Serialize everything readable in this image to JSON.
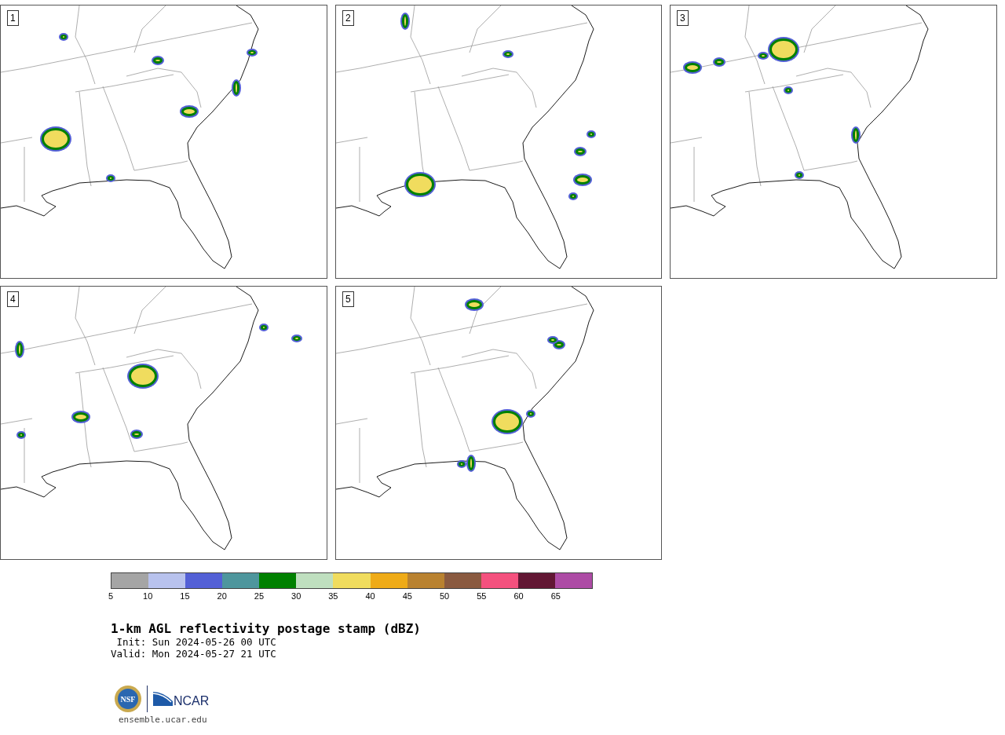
{
  "panels": [
    {
      "label": "1"
    },
    {
      "label": "2"
    },
    {
      "label": "3"
    },
    {
      "label": "4"
    },
    {
      "label": "5"
    }
  ],
  "colorbar": {
    "bins": [
      {
        "color": "#a5a5a5"
      },
      {
        "color": "#b8c2ed"
      },
      {
        "color": "#5360d6"
      },
      {
        "color": "#4e969d"
      },
      {
        "color": "#008000"
      },
      {
        "color": "#bfdfbf"
      },
      {
        "color": "#f0dc5e"
      },
      {
        "color": "#efab17"
      },
      {
        "color": "#b98230"
      },
      {
        "color": "#8a5a40"
      },
      {
        "color": "#f4517e"
      },
      {
        "color": "#621734"
      },
      {
        "color": "#ad4ba5"
      }
    ],
    "ticks": [
      "5",
      "10",
      "15",
      "20",
      "25",
      "30",
      "35",
      "40",
      "45",
      "50",
      "55",
      "60",
      "65"
    ]
  },
  "title": "1-km AGL reflectivity postage stamp (dBZ)",
  "init": " Init: Sun 2024-05-26 00 UTC",
  "valid": "Valid: Mon 2024-05-27 21 UTC",
  "logos": {
    "nsf": "NSF",
    "ncar": "NCAR"
  },
  "url": "ensemble.ucar.edu"
}
